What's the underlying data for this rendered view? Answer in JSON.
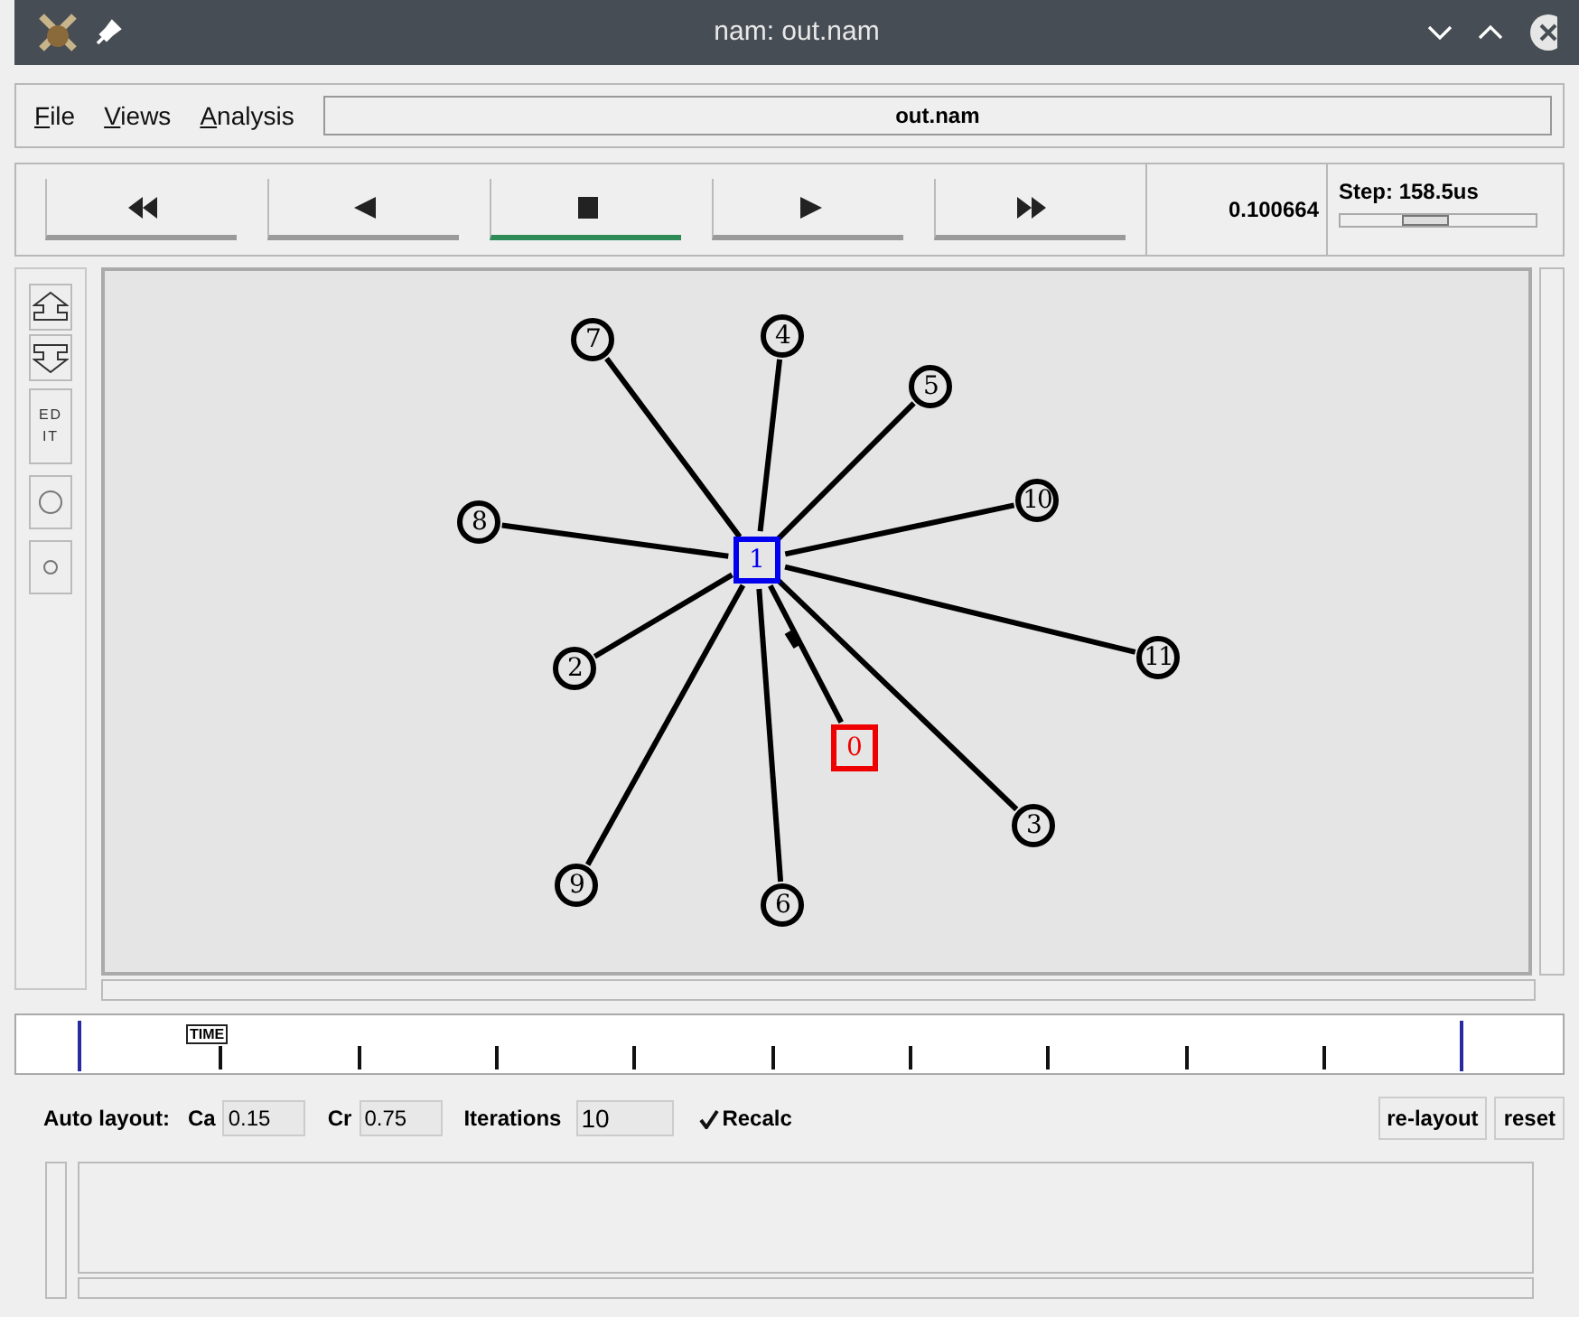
{
  "window": {
    "title": "nam: out.nam"
  },
  "menu": [
    {
      "label": "File"
    },
    {
      "label": "Views"
    },
    {
      "label": "Analysis"
    }
  ],
  "file_field": {
    "value": "out.nam"
  },
  "transport": [
    {
      "kind": "rewind",
      "selected": false
    },
    {
      "kind": "back",
      "selected": false
    },
    {
      "kind": "stop",
      "selected": true
    },
    {
      "kind": "play",
      "selected": false
    },
    {
      "kind": "forward",
      "selected": false
    }
  ],
  "time": "0.100664",
  "step": {
    "label": "Step: 158.5us",
    "level": 0.4
  },
  "toolbar": [
    {
      "kind": "zoom-in"
    },
    {
      "kind": "zoom-out"
    },
    {
      "kind": "edit",
      "label": "EDIT"
    },
    {
      "kind": "big-circle"
    },
    {
      "kind": "small-circle"
    }
  ],
  "nodes": [
    {
      "label": "7",
      "kind": "circle",
      "color": "#000000"
    },
    {
      "label": "4",
      "kind": "circle",
      "color": "#000000"
    },
    {
      "label": "5",
      "kind": "circle",
      "color": "#000000"
    },
    {
      "label": "10",
      "kind": "circle",
      "color": "#000000"
    },
    {
      "label": "8",
      "kind": "circle",
      "color": "#000000"
    },
    {
      "label": "1",
      "kind": "square",
      "color": "#0000ee"
    },
    {
      "label": "11",
      "kind": "circle",
      "color": "#000000"
    },
    {
      "label": "2",
      "kind": "circle",
      "color": "#000000"
    },
    {
      "label": "0",
      "kind": "square",
      "color": "#ee0000"
    },
    {
      "label": "3",
      "kind": "circle",
      "color": "#000000"
    },
    {
      "label": "9",
      "kind": "circle",
      "color": "#000000"
    },
    {
      "label": "6",
      "kind": "circle",
      "color": "#000000"
    }
  ],
  "timeline": {
    "marker": "TIME"
  },
  "auto_layout": {
    "label": "Auto layout:",
    "fields": [
      {
        "label": "Ca",
        "value": "0.15"
      },
      {
        "label": "Cr",
        "value": "0.75"
      },
      {
        "label": "Iterations",
        "value": "10"
      }
    ],
    "recalc": {
      "label": "Recalc",
      "checked": true
    },
    "buttons": [
      "re-layout",
      "reset"
    ]
  }
}
